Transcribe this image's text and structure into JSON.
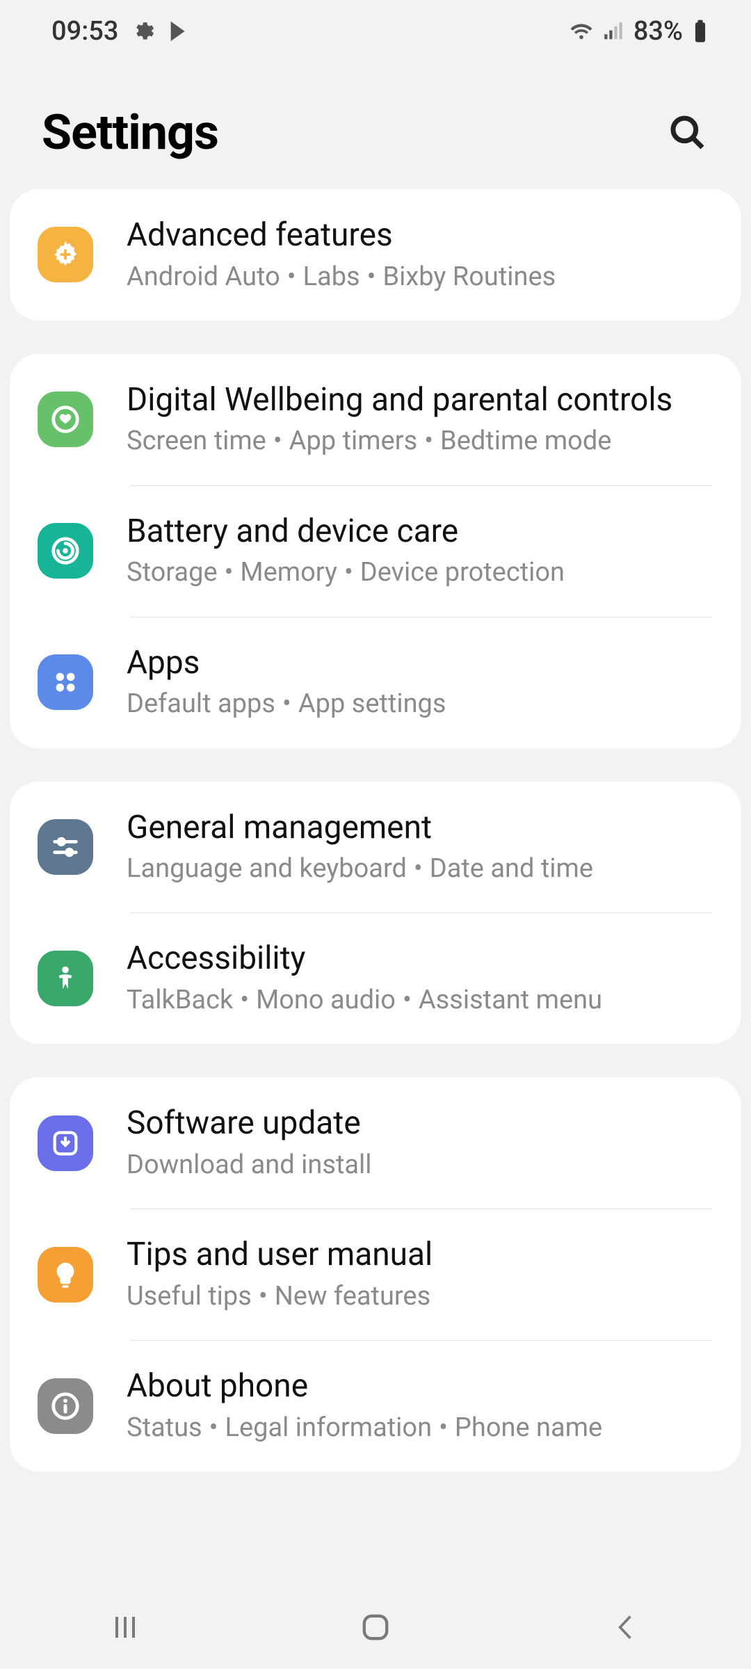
{
  "status": {
    "time": "09:53",
    "battery": "83%"
  },
  "header": {
    "title": "Settings"
  },
  "groups": [
    {
      "rows": [
        {
          "id": "advanced-features",
          "title": "Advanced features",
          "subs": [
            "Android Auto",
            "Labs",
            "Bixby Routines"
          ],
          "icon": "plus-gear-icon",
          "color": "c-amber"
        }
      ]
    },
    {
      "rows": [
        {
          "id": "digital-wellbeing",
          "title": "Digital Wellbeing and parental controls",
          "subs": [
            "Screen time",
            "App timers",
            "Bedtime mode"
          ],
          "icon": "wellbeing-icon",
          "color": "c-green1"
        },
        {
          "id": "device-care",
          "title": "Battery and device care",
          "subs": [
            "Storage",
            "Memory",
            "Device protection"
          ],
          "icon": "care-icon",
          "color": "c-teal"
        },
        {
          "id": "apps",
          "title": "Apps",
          "subs": [
            "Default apps",
            "App settings"
          ],
          "icon": "apps-icon",
          "color": "c-blue1"
        }
      ]
    },
    {
      "rows": [
        {
          "id": "general-management",
          "title": "General management",
          "subs": [
            "Language and keyboard",
            "Date and time"
          ],
          "icon": "sliders-icon",
          "color": "c-steel"
        },
        {
          "id": "accessibility",
          "title": "Accessibility",
          "subs": [
            "TalkBack",
            "Mono audio",
            "Assistant menu"
          ],
          "icon": "person-icon",
          "color": "c-green2"
        }
      ]
    },
    {
      "rows": [
        {
          "id": "software-update",
          "title": "Software update",
          "subs": [
            "Download and install"
          ],
          "icon": "update-icon",
          "color": "c-purple"
        },
        {
          "id": "tips",
          "title": "Tips and user manual",
          "subs": [
            "Useful tips",
            "New features"
          ],
          "icon": "bulb-icon",
          "color": "c-orange"
        },
        {
          "id": "about-phone",
          "title": "About phone",
          "subs": [
            "Status",
            "Legal information",
            "Phone name"
          ],
          "icon": "info-icon",
          "color": "c-grey"
        }
      ]
    }
  ]
}
